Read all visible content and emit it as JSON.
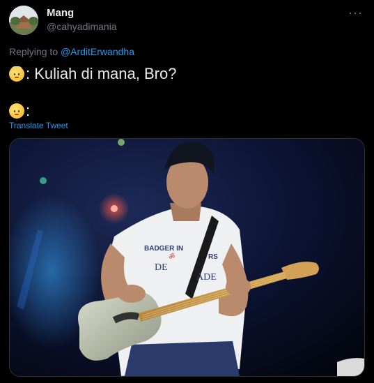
{
  "author": {
    "name": "Mang",
    "handle": "@cahyadimania"
  },
  "more_icon": "more-horizontal-icon",
  "reply": {
    "prefix": "Replying to",
    "mention": "@ArditErwandha"
  },
  "tweet": {
    "line1_text": ": Kuliah di mana, Bro?",
    "line2_text": ":",
    "translate_label": "Translate Tweet"
  },
  "media": {
    "shirt_text_1": "BADGER IN",
    "shirt_text_2": "RS",
    "shirt_text_3": "DE",
    "shirt_text_4": "ADE"
  }
}
